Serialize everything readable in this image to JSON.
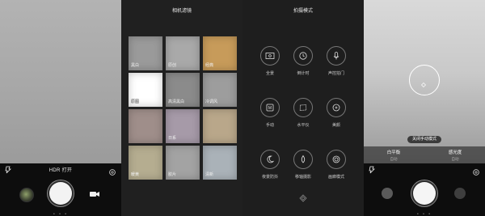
{
  "panel1": {
    "hdr_label": "HDR 打开",
    "pager": "• • •",
    "flash_icon": "flash-auto-icon",
    "settings_icon": "settings-icon"
  },
  "panel2": {
    "title": "相机滤镜",
    "filters": [
      {
        "label": "黑白",
        "color": "#9a9a9a"
      },
      {
        "label": "原创",
        "color": "#a9a9a9"
      },
      {
        "label": "经典",
        "color": "#c79b5a"
      },
      {
        "label": "原图",
        "color": "#ffffff"
      },
      {
        "label": "高清黑白",
        "color": "#8b8b8b"
      },
      {
        "label": "冷调风",
        "color": "#9d9d9d"
      },
      {
        "label": "",
        "color": "#9f8e8a"
      },
      {
        "label": "日系",
        "color": "#a69aa8"
      },
      {
        "label": "",
        "color": "#b9a78a"
      },
      {
        "label": "暖黄",
        "color": "#b5ad90"
      },
      {
        "label": "胶片",
        "color": "#a3a3a3"
      },
      {
        "label": "清新",
        "color": "#aab2b8"
      }
    ]
  },
  "panel3": {
    "title": "拍摄模式",
    "modes": [
      {
        "label": "全景",
        "icon": "panorama-icon"
      },
      {
        "label": "倒计时",
        "icon": "timer-icon"
      },
      {
        "label": "声控拍门",
        "icon": "microphone-icon"
      },
      {
        "label": "手动",
        "icon": "manual-icon"
      },
      {
        "label": "水平仪",
        "icon": "level-icon"
      },
      {
        "label": "美颜",
        "icon": "beauty-icon"
      },
      {
        "label": "夜景防抖",
        "icon": "night-icon"
      },
      {
        "label": "移轴摄影",
        "icon": "tilt-shift-icon"
      },
      {
        "label": "画廊模式",
        "icon": "gallery-mode-icon"
      }
    ]
  },
  "panel4": {
    "toast": "关闭手动模式",
    "params": [
      {
        "name": "白平衡",
        "value": "自动"
      },
      {
        "name": "感光度",
        "value": "自动"
      }
    ],
    "pager": "• • •"
  }
}
